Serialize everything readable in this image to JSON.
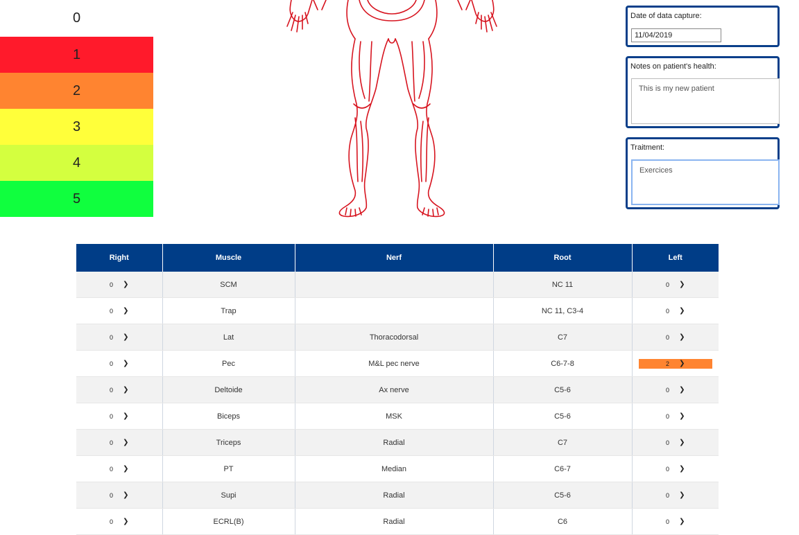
{
  "scale": [
    {
      "label": "0",
      "color": "#ffffff"
    },
    {
      "label": "1",
      "color": "#ff1a2b"
    },
    {
      "label": "2",
      "color": "#ff8430"
    },
    {
      "label": "3",
      "color": "#ffff3a"
    },
    {
      "label": "4",
      "color": "#d4ff3f"
    },
    {
      "label": "5",
      "color": "#10ff3e"
    }
  ],
  "date_panel": {
    "label": "Date of data capture:",
    "value": "11/04/2019"
  },
  "notes_panel": {
    "label": "Notes on patient's health:",
    "value": "This is my new patient"
  },
  "treatment_panel": {
    "label": "Traitment:",
    "value": "Exercices"
  },
  "table": {
    "headers": [
      "Right",
      "Muscle",
      "Nerf",
      "Root",
      "Left"
    ],
    "rows": [
      {
        "right": "0",
        "muscle": "SCM",
        "nerf": "",
        "root": "NC 11",
        "left": "0"
      },
      {
        "right": "0",
        "muscle": "Trap",
        "nerf": "",
        "root": "NC 11, C3-4",
        "left": "0"
      },
      {
        "right": "0",
        "muscle": "Lat",
        "nerf": "Thoracodorsal",
        "root": "C7",
        "left": "0"
      },
      {
        "right": "0",
        "muscle": "Pec",
        "nerf": "M&L pec nerve",
        "root": "C6-7-8",
        "left": "2"
      },
      {
        "right": "0",
        "muscle": "Deltoide",
        "nerf": "Ax nerve",
        "root": "C5-6",
        "left": "0"
      },
      {
        "right": "0",
        "muscle": "Biceps",
        "nerf": "MSK",
        "root": "C5-6",
        "left": "0"
      },
      {
        "right": "0",
        "muscle": "Triceps",
        "nerf": "Radial",
        "root": "C7",
        "left": "0"
      },
      {
        "right": "0",
        "muscle": "PT",
        "nerf": "Median",
        "root": "C6-7",
        "left": "0"
      },
      {
        "right": "0",
        "muscle": "Supi",
        "nerf": "Radial",
        "root": "C5-6",
        "left": "0"
      },
      {
        "right": "0",
        "muscle": "ECRL(B)",
        "nerf": "Radial",
        "root": "C6",
        "left": "0"
      }
    ]
  },
  "colors": {
    "header_bg": "#003d87",
    "panel_border": "#0a3f8a",
    "figure_stroke": "#d7141f"
  },
  "icons": {
    "dropdown": "chevron-down-icon"
  }
}
